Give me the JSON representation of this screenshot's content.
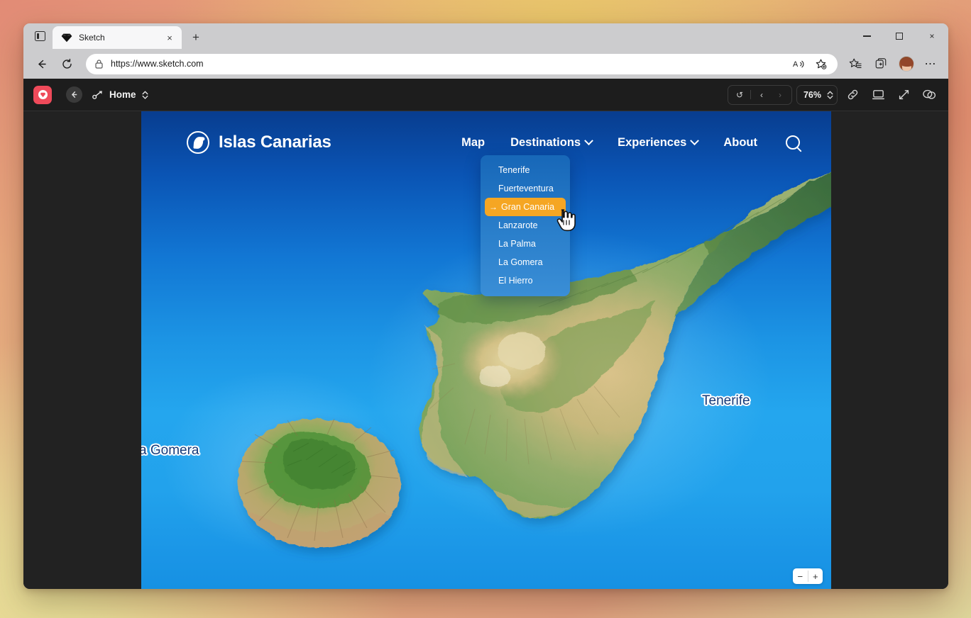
{
  "browser": {
    "tab": {
      "title": "Sketch",
      "favicon": "sketch-diamond-icon",
      "close": "×"
    },
    "new_tab": "+",
    "window_controls": {
      "minimize": "minimize-icon",
      "maximize": "maximize-icon",
      "close": "×"
    },
    "url": "https://www.sketch.com",
    "lock": "lock-icon",
    "back": "←",
    "reload": "↻",
    "read_aloud": "read-aloud-icon",
    "favorites_add": "add-favorite-icon",
    "collections": "collections-icon",
    "split_screen": "split-screen-icon",
    "profile": "profile-avatar",
    "settings_more": "⋯"
  },
  "sketch": {
    "logo": "sketch-logo",
    "back_label": "←",
    "document_name": "Home",
    "prototype_icon": "prototype-icon",
    "stepper_icon": "chevron-updown-icon",
    "undo": "↺",
    "prev": "‹",
    "next": "›",
    "zoom_value": "76%",
    "zoom_stepper": "chevron-updown-icon",
    "share_link": "link-icon",
    "present": "present-icon",
    "fullscreen": "fullscreen-icon",
    "comments": "comments-icon"
  },
  "site": {
    "brand": {
      "name": "Islas Canarias",
      "mark": "leaf-bird-logo"
    },
    "nav": [
      {
        "label": "Map",
        "has_chevron": false
      },
      {
        "label": "Destinations",
        "has_chevron": true
      },
      {
        "label": "Experiences",
        "has_chevron": true
      },
      {
        "label": "About",
        "has_chevron": false
      }
    ],
    "search_icon": "search-icon",
    "dropdown": {
      "open_for": "Destinations",
      "items": [
        {
          "label": "Tenerife",
          "active": false
        },
        {
          "label": "Fuerteventura",
          "active": false
        },
        {
          "label": "Gran Canaria",
          "active": true,
          "arrow": "→"
        },
        {
          "label": "Lanzarote",
          "active": false
        },
        {
          "label": "La Palma",
          "active": false
        },
        {
          "label": "La Gomera",
          "active": false
        },
        {
          "label": "El Hierro",
          "active": false
        }
      ],
      "highlight_color": "#f5a623"
    },
    "map": {
      "labels": [
        {
          "name": "Tenerife",
          "text": "Tenerife"
        },
        {
          "name": "La Gomera",
          "text": "a Gomera"
        }
      ],
      "zoom_out": "−",
      "zoom_in": "+"
    }
  },
  "colors": {
    "accent_orange": "#f5a623",
    "sketch_red": "#ef4a5a",
    "ocean_top": "#083d8f",
    "ocean_bottom": "#1590e2",
    "label_blue": "#153a7a"
  }
}
